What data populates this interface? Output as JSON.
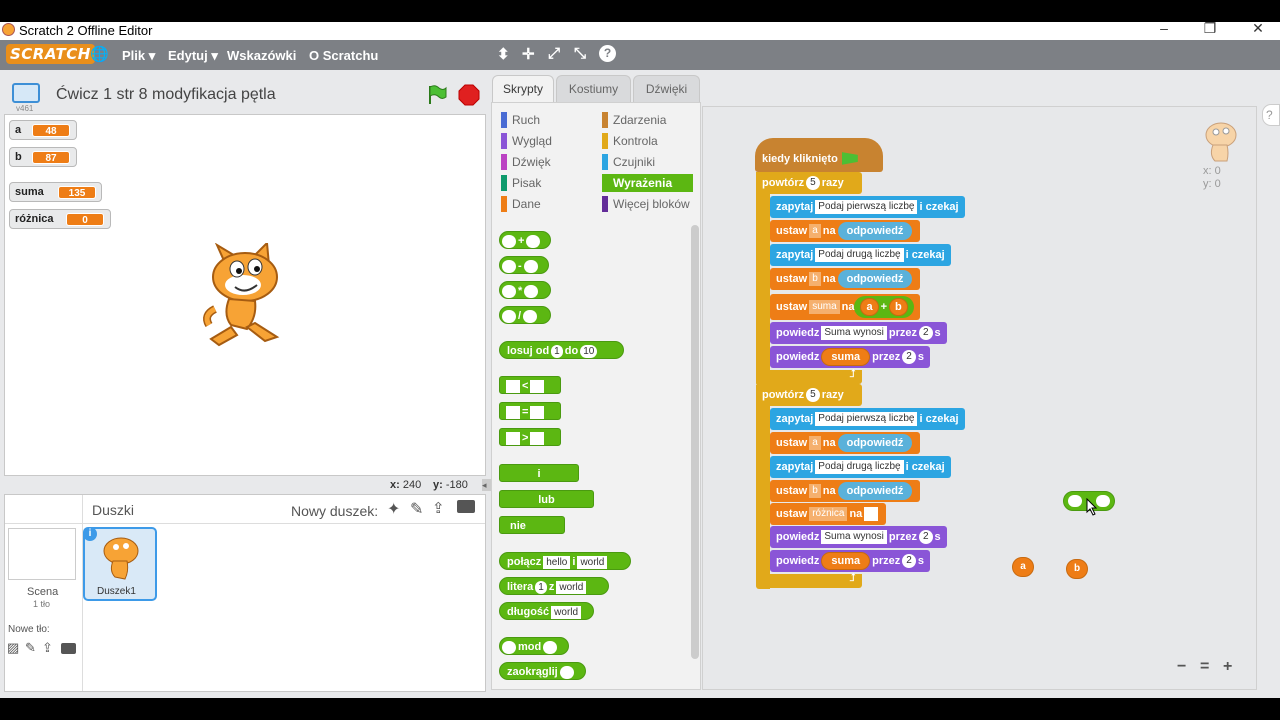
{
  "window": {
    "title": "Scratch 2 Offline Editor",
    "min": "–",
    "restore": "❐",
    "close": "✕"
  },
  "menu": {
    "logo": "SCRATCH",
    "globe": "🌐",
    "items": [
      "Plik ▾",
      "Edytuj ▾",
      "Wskazówki",
      "O Scratchu"
    ],
    "tools": [
      "⬍",
      "✛",
      "⤢",
      "⤡",
      "?"
    ]
  },
  "stage": {
    "project_title": "Ćwicz 1 str 8 modyfikacja pętla",
    "version": "v461",
    "coords_x_label": "x:",
    "coords_x": "240",
    "coords_y_label": "y:",
    "coords_y": "-180"
  },
  "variables": [
    {
      "name": "a",
      "value": "48"
    },
    {
      "name": "b",
      "value": "87"
    },
    {
      "name": "suma",
      "value": "135"
    },
    {
      "name": "różnica",
      "value": "0"
    }
  ],
  "tabs": [
    "Skrypty",
    "Kostiumy",
    "Dźwięki"
  ],
  "categories_left": [
    {
      "label": "Ruch",
      "color": "#4a6cd4"
    },
    {
      "label": "Wygląd",
      "color": "#8a55d7"
    },
    {
      "label": "Dźwięk",
      "color": "#bb42c3"
    },
    {
      "label": "Pisak",
      "color": "#0e9a6c"
    },
    {
      "label": "Dane",
      "color": "#ee7d16"
    }
  ],
  "categories_right": [
    {
      "label": "Zdarzenia",
      "color": "#c88330"
    },
    {
      "label": "Kontrola",
      "color": "#e1a91a"
    },
    {
      "label": "Czujniki",
      "color": "#2ca5e2"
    },
    {
      "label": "Wyrażenia",
      "color": "#5cb712"
    },
    {
      "label": "Więcej bloków",
      "color": "#632d99"
    }
  ],
  "palette": {
    "op_plus": "+",
    "op_minus": "-",
    "op_mult": "*",
    "op_div": "/",
    "random_label": "losuj od",
    "random_from": "1",
    "random_to_label": "do",
    "random_to": "10",
    "lt": "<",
    "eq": "=",
    "gt": ">",
    "and": "i",
    "or": "lub",
    "not": "nie",
    "join": "połącz",
    "join_a": "hello",
    "join_b": "world",
    "letter": "litera",
    "letter_n": "1",
    "letter_of": "z",
    "letter_s": "world",
    "length": "długość",
    "length_s": "world",
    "mod": "mod",
    "round": "zaokrąglij"
  },
  "script": {
    "hat": "kiedy kliknięto",
    "repeat": "powtórz",
    "repeat_n": "5",
    "repeat_unit": "razy",
    "ask": "zapytaj",
    "ask_first": "Podaj pierwszą liczbę",
    "ask_second": "Podaj drugą liczbę",
    "ask_wait": "i czekaj",
    "set": "ustaw",
    "to": "na",
    "answer": "odpowiedź",
    "var_a": "a",
    "var_b": "b",
    "var_suma": "suma",
    "var_roznica": "różnica",
    "plus": "+",
    "say": "powiedz",
    "say_text": "Suma wynosi",
    "for": "przez",
    "secs": "2",
    "s": "s",
    "loose_a": "a",
    "loose_b": "b",
    "sprite_x": "x: 0",
    "sprite_y": "y: 0",
    "zoom_out": "−",
    "zoom_reset": "=",
    "zoom_in": "+"
  },
  "sprites": {
    "header": "Duszki",
    "new_sprite": "Nowy duszek:",
    "stage_label": "Scena",
    "stage_backdrops": "1 tło",
    "new_backdrop": "Nowe tło:",
    "sprite1": "Duszek1"
  },
  "colors": {
    "events": "#c88330",
    "control": "#e1a91a",
    "sensing": "#2ca5e2",
    "data": "#ee7d16",
    "looks": "#8a55d7",
    "operators": "#5cb712"
  }
}
